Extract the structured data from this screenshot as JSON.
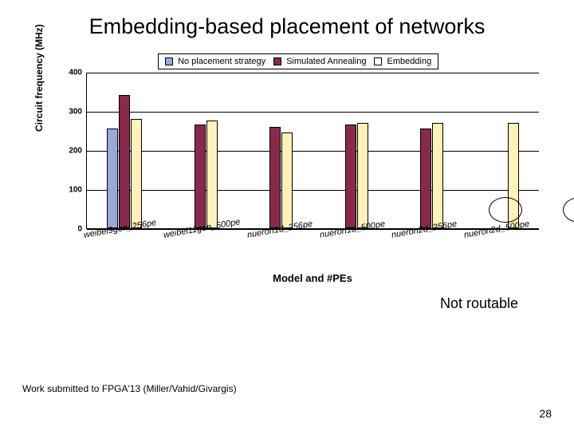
{
  "title": "Embedding-based placement of networks",
  "chart_data": {
    "type": "bar",
    "title": "",
    "ylabel": "Circuit frequency (MHz)",
    "xlabel": "Model and #PEs",
    "ylim": [
      0,
      400
    ],
    "yticks": [
      0,
      100,
      200,
      300,
      400
    ],
    "categories": [
      "weibel9gen_256pe",
      "weibel11gen_500pe",
      "nueron1d_256pe",
      "nueron1d_500pe",
      "nueron2d_256pe",
      "nueron2d_500pe"
    ],
    "series": [
      {
        "name": "No placement strategy",
        "color": "#9aa8d8",
        "values": [
          255,
          0,
          0,
          0,
          0,
          0
        ]
      },
      {
        "name": "Simulated Annealing",
        "color": "#8a2a4a",
        "values": [
          340,
          265,
          260,
          265,
          255,
          0
        ]
      },
      {
        "name": "Embedding",
        "color": "#fff2b8",
        "values": [
          280,
          275,
          245,
          270,
          270,
          270
        ]
      }
    ],
    "legend": {
      "items": [
        "No placement strategy",
        "Simulated Annealing",
        "Embedding"
      ]
    }
  },
  "annotation": "Not routable",
  "footnote": "Work submitted to FPGA'13 (Miller/Vahid/Givargis)",
  "page_number": "28"
}
